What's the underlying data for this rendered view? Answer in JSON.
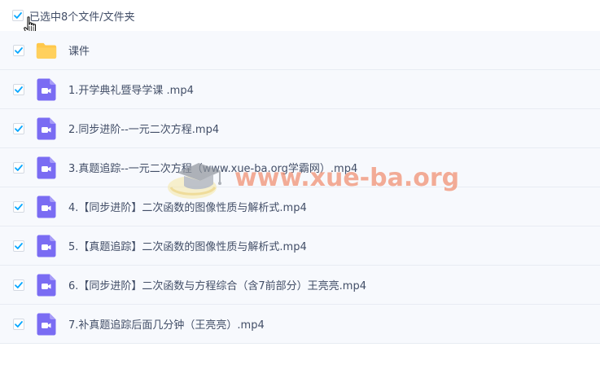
{
  "header": {
    "selection_text": "已选中8个文件/文件夹",
    "checked": true
  },
  "items": [
    {
      "type": "folder",
      "label": "课件",
      "checked": true
    },
    {
      "type": "video",
      "label": "1.开学典礼暨导学课 .mp4",
      "checked": true
    },
    {
      "type": "video",
      "label": "2.同步进阶--一元二次方程.mp4",
      "checked": true
    },
    {
      "type": "video",
      "label": "3.真题追踪--一元二次方程（www.xue-ba.org学霸网）.mp4",
      "checked": true
    },
    {
      "type": "video",
      "label": "4.【同步进阶】二次函数的图像性质与解析式.mp4",
      "checked": true
    },
    {
      "type": "video",
      "label": "5.【真题追踪】二次函数的图像性质与解析式.mp4",
      "checked": true
    },
    {
      "type": "video",
      "label": "6.【同步进阶】二次函数与方程综合（含7前部分）王亮亮.mp4",
      "checked": true
    },
    {
      "type": "video",
      "label": "7.补真题追踪后面几分钟（王亮亮）.mp4",
      "checked": true
    }
  ],
  "watermark": {
    "text": "www.xue-ba.org"
  },
  "colors": {
    "checkbox_check": "#06a7ff",
    "folder": "#ffc84b",
    "video_icon": "#7a6cf3",
    "row_background": "#f7f9fd",
    "watermark": "#f08b6b"
  }
}
